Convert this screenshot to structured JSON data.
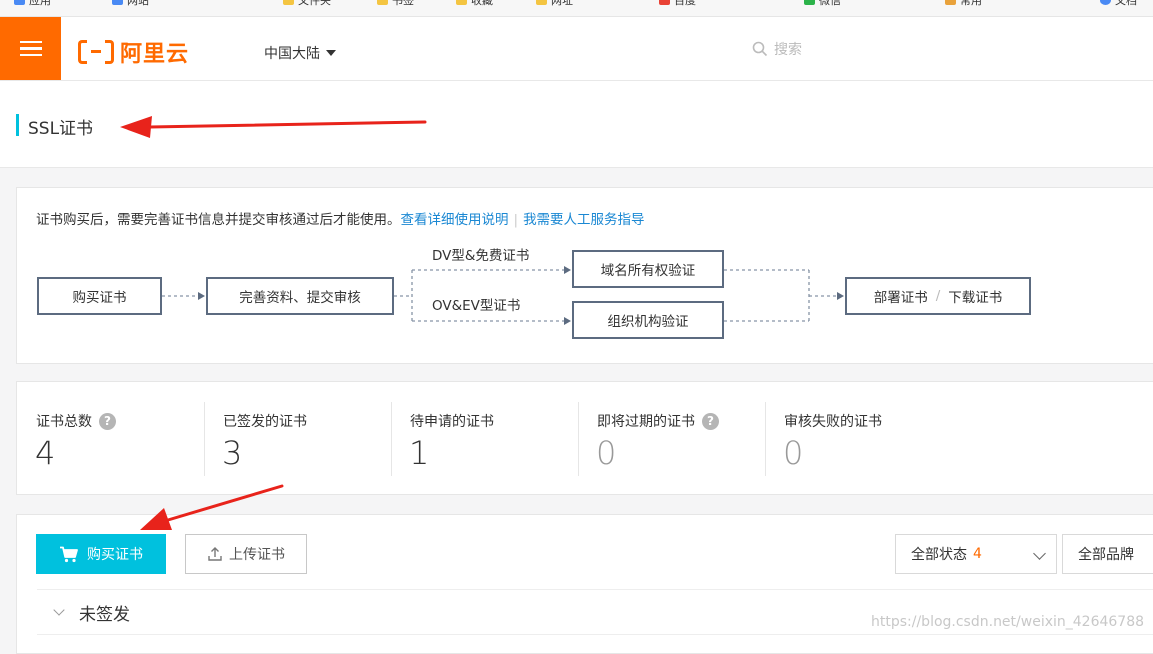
{
  "bookmarks": [
    {
      "label": "应用",
      "color": "#4a8af4"
    },
    {
      "label": "网站",
      "color": "#4a8af4"
    },
    {
      "label": "文件夹",
      "color": "#f4c542"
    },
    {
      "label": "书签",
      "color": "#f4c542"
    },
    {
      "label": "收藏",
      "color": "#f4c542"
    },
    {
      "label": "网址",
      "color": "#f4c542"
    },
    {
      "label": "百度",
      "color": "#e94235"
    },
    {
      "label": "微信",
      "color": "#2cb34a"
    },
    {
      "label": "常用",
      "color": "#e9a23b"
    },
    {
      "label": "文档",
      "color": "#4a8af4"
    }
  ],
  "header": {
    "logo_text": "阿里云",
    "region": "中国大陆",
    "search_placeholder": "搜索"
  },
  "page": {
    "title": "SSL证书"
  },
  "flow": {
    "note": "证书购买后，需要完善证书信息并提交审核通过后才能使用。",
    "link_details": "查看详细使用说明",
    "link_service": "我需要人工服务指导",
    "step_buy": "购买证书",
    "step_submit": "完善资料、提交审核",
    "branch_dv": "DV型&免费证书",
    "branch_ov": "OV&EV型证书",
    "step_domain": "域名所有权验证",
    "step_org": "组织机构验证",
    "step_deploy": "部署证书",
    "step_download": "下载证书"
  },
  "stats": [
    {
      "label": "证书总数",
      "value": "4",
      "help": true
    },
    {
      "label": "已签发的证书",
      "value": "3",
      "help": false
    },
    {
      "label": "待申请的证书",
      "value": "1",
      "help": false
    },
    {
      "label": "即将过期的证书",
      "value": "0",
      "help": true
    },
    {
      "label": "审核失败的证书",
      "value": "0",
      "help": false
    }
  ],
  "toolbar": {
    "buy_label": "购买证书",
    "upload_label": "上传证书",
    "status_filter": "全部状态",
    "status_count": "4",
    "brand_filter": "全部品牌"
  },
  "group": {
    "label": "未签发"
  },
  "watermark": "https://blog.csdn.net/weixin_42646788",
  "colors": {
    "accent": "#ff6a00",
    "primary": "#00c1de",
    "link": "#1b88d3",
    "annotation": "#e8231b"
  }
}
